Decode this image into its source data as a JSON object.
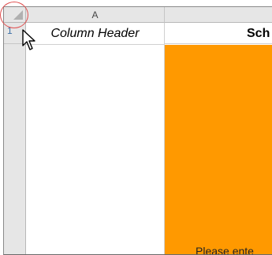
{
  "spreadsheet": {
    "column_headers": [
      "A"
    ],
    "row_headers": [
      "1"
    ],
    "cells": {
      "A1": "Column Header",
      "B1": "Sch",
      "B_body_partial_text": "Please ente"
    },
    "colors": {
      "orange_fill": "#ff9900",
      "highlight_circle": "#e05050"
    }
  },
  "icons": {
    "select_all": "select-all-triangle",
    "cursor": "mouse-pointer"
  }
}
